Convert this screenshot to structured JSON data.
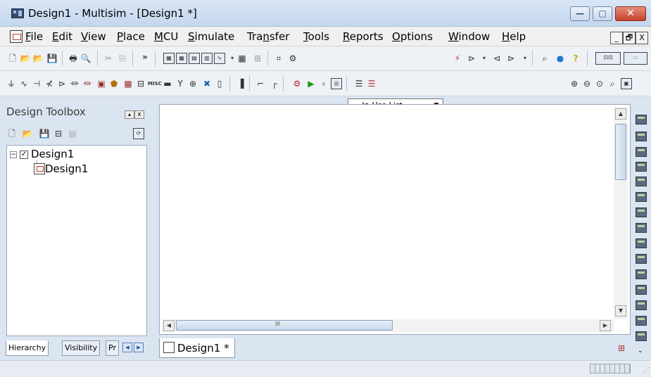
{
  "window": {
    "title": "Design1 - Multisim - [Design1 *]",
    "minimize_glyph": "—",
    "restore_glyph": "▢",
    "close_glyph": "✕"
  },
  "menu": {
    "items": [
      {
        "pre": "",
        "acc": "F",
        "post": "ile"
      },
      {
        "pre": "",
        "acc": "E",
        "post": "dit"
      },
      {
        "pre": "",
        "acc": "V",
        "post": "iew"
      },
      {
        "pre": "",
        "acc": "P",
        "post": "lace"
      },
      {
        "pre": "",
        "acc": "M",
        "post": "CU"
      },
      {
        "pre": "",
        "acc": "S",
        "post": "imulate"
      },
      {
        "pre": "Tra",
        "acc": "n",
        "post": "sfer"
      },
      {
        "pre": "",
        "acc": "T",
        "post": "ools"
      },
      {
        "pre": "",
        "acc": "R",
        "post": "eports"
      },
      {
        "pre": "",
        "acc": "O",
        "post": "ptions"
      },
      {
        "pre": "",
        "acc": "W",
        "post": "indow"
      },
      {
        "pre": "",
        "acc": "H",
        "post": "elp"
      }
    ],
    "mdi_min": "_",
    "mdi_restore": "🗗",
    "mdi_close": "X"
  },
  "toolbar": {
    "in_use_list": "--- In-Use List ---",
    "overflow": "»",
    "misc_label": "MISC"
  },
  "toolbox": {
    "title": "Design Toolbox",
    "pin_glyph": "▴",
    "close_glyph": "x",
    "tree_root": "Design1",
    "tree_child": "Design1",
    "tabs": [
      "Hierarchy",
      "Visibility",
      "Pr"
    ]
  },
  "document": {
    "tab_label": "Design1 *",
    "scroll_mark": "III"
  },
  "colors": {
    "title_bar": "#c4d7ee",
    "close_button": "#c2422b",
    "panel_bg": "#dbe5f1"
  }
}
